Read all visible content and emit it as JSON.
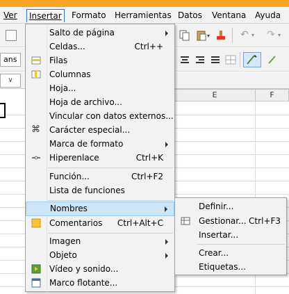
{
  "menubar": {
    "items": [
      "Ver",
      "Insertar",
      "Formato",
      "Herramientas",
      "Datos",
      "Ventana",
      "Ayuda"
    ]
  },
  "toolbar": {
    "font_name": "ans",
    "name_box": "∨"
  },
  "columns": [
    "E",
    "F"
  ],
  "insert_menu": {
    "items": [
      {
        "label": "Salto de página",
        "shortcut": "",
        "submenu": true
      },
      {
        "label": "Celdas...",
        "shortcut": "Ctrl++"
      },
      {
        "label": "Filas",
        "shortcut": ""
      },
      {
        "label": "Columnas",
        "shortcut": ""
      },
      {
        "label": "Hoja...",
        "shortcut": ""
      },
      {
        "label": "Hoja de archivo...",
        "shortcut": ""
      },
      {
        "label": "Vincular con datos externos...",
        "shortcut": ""
      },
      {
        "label": "Carácter especial...",
        "shortcut": ""
      },
      {
        "label": "Marca de formato",
        "shortcut": "",
        "submenu": true
      },
      {
        "label": "Hiperenlace",
        "shortcut": "Ctrl+K"
      },
      {
        "label": "Función...",
        "shortcut": "Ctrl+F2"
      },
      {
        "label": "Lista de funciones",
        "shortcut": ""
      },
      {
        "label": "Nombres",
        "shortcut": "",
        "submenu": true
      },
      {
        "label": "Comentarios",
        "shortcut": "Ctrl+Alt+C"
      },
      {
        "label": "Imagen",
        "shortcut": "",
        "submenu": true
      },
      {
        "label": "Objeto",
        "shortcut": "",
        "submenu": true
      },
      {
        "label": "Vídeo y sonido...",
        "shortcut": ""
      },
      {
        "label": "Marco flotante...",
        "shortcut": ""
      }
    ]
  },
  "names_submenu": {
    "items": [
      {
        "label": "Definir...",
        "shortcut": ""
      },
      {
        "label": "Gestionar...",
        "shortcut": "Ctrl+F3"
      },
      {
        "label": "Insertar...",
        "shortcut": ""
      },
      {
        "label": "Crear...",
        "shortcut": ""
      },
      {
        "label": "Etiquetas...",
        "shortcut": ""
      }
    ]
  },
  "colors": {
    "highlight": "#cce4f7",
    "menu_bg": "#f2f2f2",
    "accent": "#f6a623"
  }
}
